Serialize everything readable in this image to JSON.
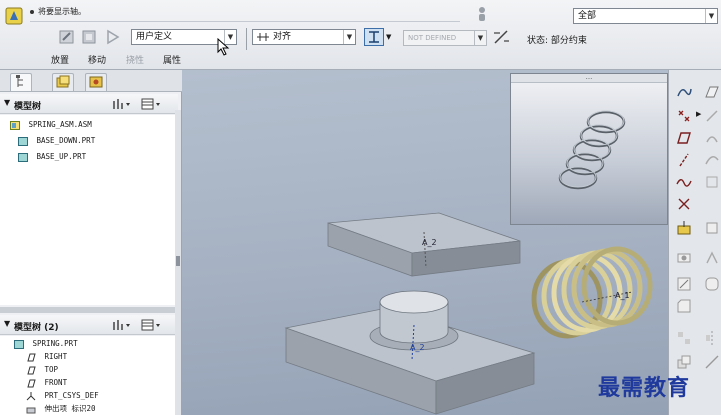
{
  "message": {
    "text": "将要显示轴。"
  },
  "search": {
    "value": "全部"
  },
  "dashboard": {
    "tabs": [
      {
        "label": "放置"
      },
      {
        "label": "移动"
      },
      {
        "label": "挠性"
      },
      {
        "label": "属性"
      }
    ],
    "user_defined_select": {
      "value": "用户定义"
    },
    "constraint_select": {
      "value": "对齐"
    },
    "offset_select": {
      "value": "NOT DEFINED"
    },
    "status_text": "状态: 部分约束"
  },
  "model_tree_top": {
    "title": "模型树",
    "nodes": [
      {
        "label": "SPRING_ASM.ASM"
      },
      {
        "label": "BASE_DOWN.PRT"
      },
      {
        "label": "BASE_UP.PRT"
      }
    ]
  },
  "model_tree_bottom": {
    "title": "模型树 (2)",
    "nodes": [
      {
        "label": "SPRING.PRT"
      },
      {
        "label": "RIGHT"
      },
      {
        "label": "TOP"
      },
      {
        "label": "FRONT"
      },
      {
        "label": "PRT_CSYS_DEF"
      },
      {
        "label": "伸出项 标识20"
      }
    ]
  },
  "viewport": {
    "preview_title": "...",
    "axis_labels": {
      "upper_plate": "A_2",
      "lower_plate": "A_2",
      "spring": "A_1"
    }
  },
  "watermark": "最需教育",
  "colors": {
    "viewport_bg": "#a9b4c5",
    "plate_top": "#b8bfc8",
    "plate_side": "#8e949c",
    "spring": "#d9cf98",
    "watermark": "#1f3a9c"
  }
}
